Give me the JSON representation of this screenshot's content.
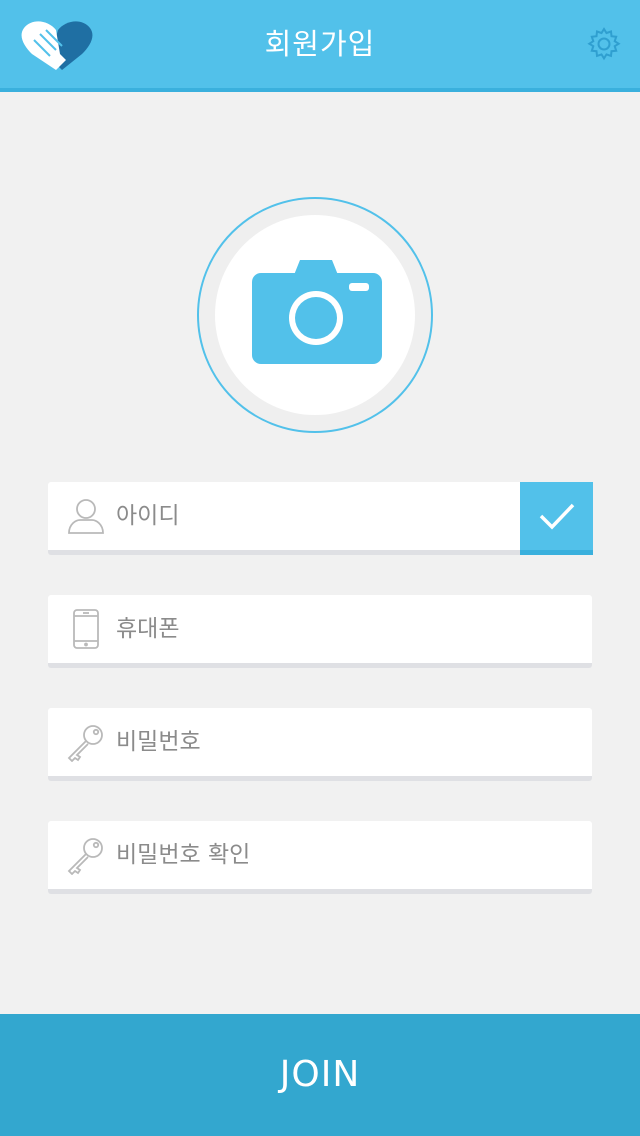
{
  "header": {
    "title": "회원가입",
    "logo_icon": "hands-heart-logo",
    "settings_icon": "gear-icon",
    "background": "#52c1ea"
  },
  "photo": {
    "icon": "camera-icon",
    "accent": "#52c1ea"
  },
  "form": {
    "id_label": "아이디",
    "phone_label": "휴대폰",
    "password_label": "비밀번호",
    "password_confirm_label": "비밀번호 확인",
    "check_icon": "checkmark-icon"
  },
  "footer": {
    "join_label": "JOIN",
    "background": "#33a7cf"
  }
}
